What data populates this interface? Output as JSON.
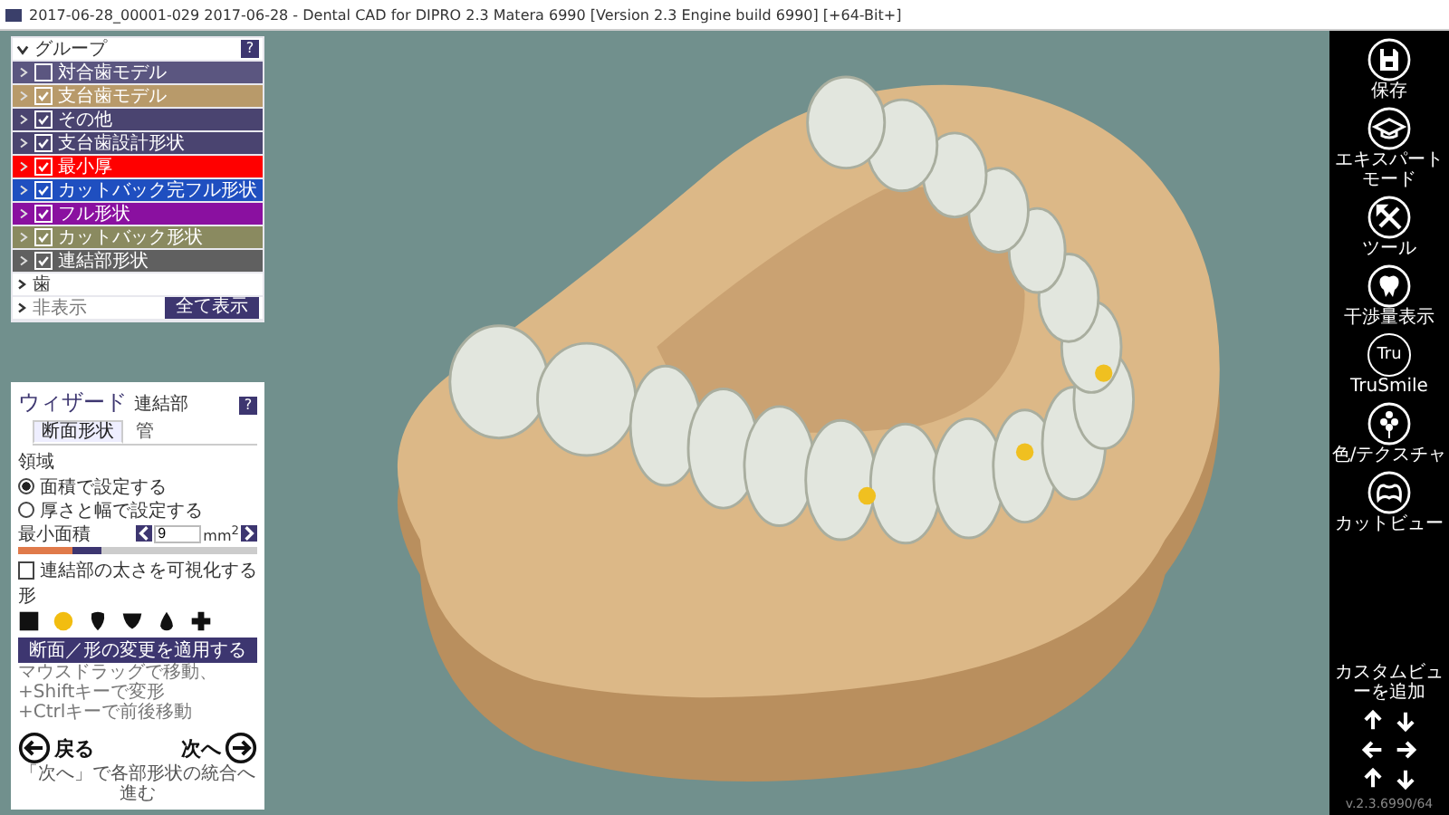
{
  "window": {
    "title": "2017-06-28_00001-029 2017-06-28 - Dental CAD for DIPRO 2.3 Matera 6990 [Version 2.3 Engine build 6990] [+64-Bit+]"
  },
  "groups": {
    "title": "グループ",
    "help": "?",
    "expanded": true,
    "items": [
      {
        "label": "対合歯モデル",
        "checked": false,
        "color": "#5b5680"
      },
      {
        "label": "支台歯モデル",
        "checked": true,
        "color": "#b89a6a"
      },
      {
        "label": "その他",
        "checked": true,
        "color": "#4a4470"
      },
      {
        "label": "支台歯設計形状",
        "checked": true,
        "color": "#4a4470"
      },
      {
        "label": "最小厚",
        "checked": true,
        "color": "#ff0000"
      },
      {
        "label": "カットバック完フル形状",
        "checked": true,
        "color": "#1f4fc0"
      },
      {
        "label": "フル形状",
        "checked": true,
        "color": "#8a10a0"
      },
      {
        "label": "カットバック形状",
        "checked": true,
        "color": "#8a8a60"
      },
      {
        "label": "連結部形状",
        "checked": true,
        "color": "#606060"
      }
    ],
    "teeth_row": "歯",
    "hidden_row": "非表示",
    "show_all_button": "全て表示"
  },
  "wizard": {
    "title": "ウィザード",
    "subtitle": "連結部",
    "help": "?",
    "tabs": [
      {
        "label": "断面形状",
        "selected": true
      },
      {
        "label": "管",
        "selected": false
      }
    ],
    "area_label": "領域",
    "radios": [
      {
        "label": "面積で設定する",
        "selected": true
      },
      {
        "label": "厚さと幅で設定する",
        "selected": false
      }
    ],
    "min_area": {
      "label": "最小面積",
      "value": "9",
      "unit": "mm$^{2}$",
      "level": 0.35
    },
    "visualize": {
      "label": "連結部の太さを可視化する",
      "checked": false
    },
    "shape_label": "形",
    "shapes": [
      {
        "kind": "square",
        "selected": false
      },
      {
        "kind": "circle",
        "selected": true
      },
      {
        "kind": "drop",
        "selected": false
      },
      {
        "kind": "shield",
        "selected": false
      },
      {
        "kind": "flame",
        "selected": false
      },
      {
        "kind": "plus",
        "selected": false
      }
    ],
    "apply_button": "断面／形の変更を適用する",
    "hints": [
      "マウスドラッグで移動、+Shiftキーで変形",
      "+Ctrlキーで前後移動"
    ],
    "back": "戻る",
    "next": "次へ",
    "footer": "「次へ」で各部形状の統合へ進む"
  },
  "toolbar": {
    "tools": [
      {
        "kind": "save",
        "label": "保存"
      },
      {
        "kind": "expert",
        "label": "エキスパートモード"
      },
      {
        "kind": "tools",
        "label": "ツール"
      },
      {
        "kind": "interference",
        "label": "干渉量表示"
      },
      {
        "kind": "trusmile",
        "label": "TruSmile",
        "icon_text": "Tru"
      },
      {
        "kind": "texture",
        "label": "色/テクスチャ"
      },
      {
        "kind": "cutview",
        "label": "カットビュー"
      }
    ],
    "custom_view": "カスタムビューを追加",
    "version": "v.2.3.6990/64"
  }
}
